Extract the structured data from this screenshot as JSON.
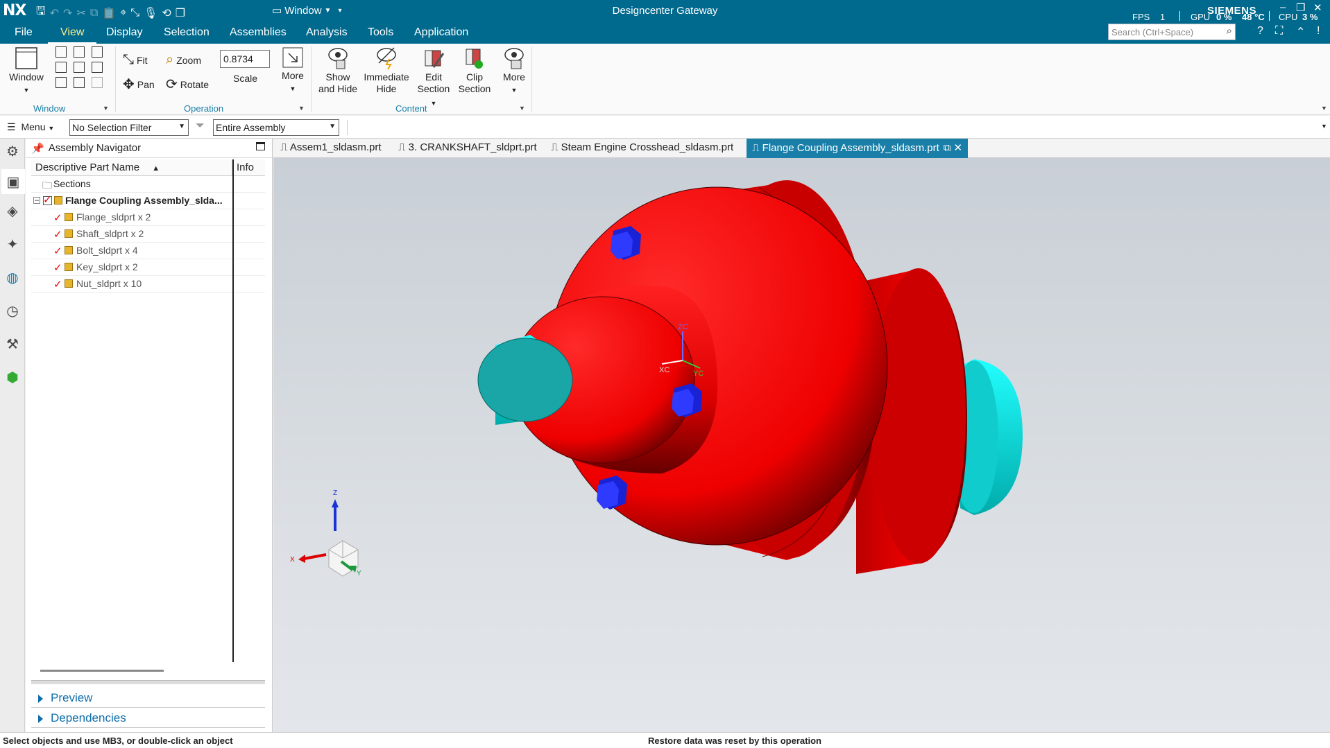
{
  "app": {
    "logo": "NX",
    "title": "Designcenter Gateway",
    "window_menu": "Window",
    "brand": "SIEMENS",
    "fps_label": "FPS",
    "fps_value": "1",
    "gpu_label": "GPU",
    "gpu_value": "0 %",
    "gpu_temp": "48 °C",
    "cpu_label": "CPU",
    "cpu_value": "3 %"
  },
  "menu": {
    "items": [
      "File",
      "View",
      "Display",
      "Selection",
      "Assemblies",
      "Analysis",
      "Tools",
      "Application"
    ],
    "active": "View"
  },
  "search": {
    "placeholder": "Search (Ctrl+Space)"
  },
  "ribbon": {
    "window_btn": "Window",
    "window_group": "Window",
    "fit": "Fit",
    "zoom": "Zoom",
    "pan": "Pan",
    "rotate": "Rotate",
    "scale_value": "0.8734",
    "scale_label": "Scale",
    "more1": "More",
    "operation_group": "Operation",
    "show_hide_1": "Show",
    "show_hide_2": "and Hide",
    "imm_hide_1": "Immediate",
    "imm_hide_2": "Hide",
    "edit_sec_1": "Edit",
    "edit_sec_2": "Section",
    "clip_sec_1": "Clip",
    "clip_sec_2": "Section",
    "more2": "More",
    "content_group": "Content"
  },
  "filterbar": {
    "menu": "Menu",
    "selection_filter": "No Selection Filter",
    "scope": "Entire Assembly"
  },
  "navigator": {
    "title": "Assembly Navigator",
    "col_name": "Descriptive Part Name",
    "col_info": "Info",
    "sections": "Sections",
    "root": "Flange Coupling Assembly_slda...",
    "children": [
      "Flange_sldprt x 2",
      "Shaft_sldprt x 2",
      "Bolt_sldprt x 4",
      "Key_sldprt x 2",
      "Nut_sldprt x 10"
    ],
    "preview": "Preview",
    "dependencies": "Dependencies"
  },
  "tabs": [
    "Assem1_sldasm.prt",
    "3. CRANKSHAFT_sldprt.prt",
    "Steam Engine Crosshead_sldasm.prt",
    "Flange Coupling Assembly_sldasm.prt"
  ],
  "axes": {
    "zc": "ZC",
    "xc": "XC",
    "yc": "YC",
    "z": "Z",
    "x": "X",
    "y": "Y"
  },
  "status": {
    "left": "Select objects and use MB3, or double-click an object",
    "center": "Restore data was reset by this operation"
  },
  "colors": {
    "brand_bar": "#006a8e",
    "active_tab": "#1a7fa8",
    "flange": "#ee1111",
    "shaft": "#19d9d9",
    "bolt": "#1a22d6"
  }
}
